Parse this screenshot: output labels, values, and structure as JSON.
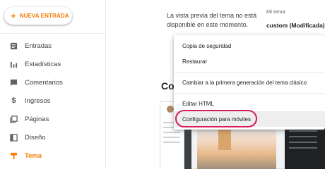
{
  "sidebar": {
    "new_post_label": "NUEVA ENTRADA",
    "items": [
      {
        "label": "Entradas",
        "icon": "posts-icon"
      },
      {
        "label": "Estadísticas",
        "icon": "stats-icon"
      },
      {
        "label": "Comentarios",
        "icon": "comments-icon"
      },
      {
        "label": "Ingresos",
        "icon": "dollar-icon"
      },
      {
        "label": "Páginas",
        "icon": "pages-icon"
      },
      {
        "label": "Diseño",
        "icon": "layout-icon"
      },
      {
        "label": "Tema",
        "icon": "theme-icon",
        "active": true
      }
    ]
  },
  "main": {
    "preview_unavailable": "La vista previa del tema no está disponible en este momento.",
    "my_theme_label": "Mi tema",
    "my_theme_value": "custom (Modificada)",
    "section_heading": "Con"
  },
  "menu": {
    "items": [
      "Copia de seguridad",
      "Restaurar",
      "Cambiar a la primera generación del tema clásico",
      "Editar HTML",
      "Configuración para móviles"
    ]
  },
  "colors": {
    "accent": "#f57c00",
    "highlight": "#d81b60"
  }
}
